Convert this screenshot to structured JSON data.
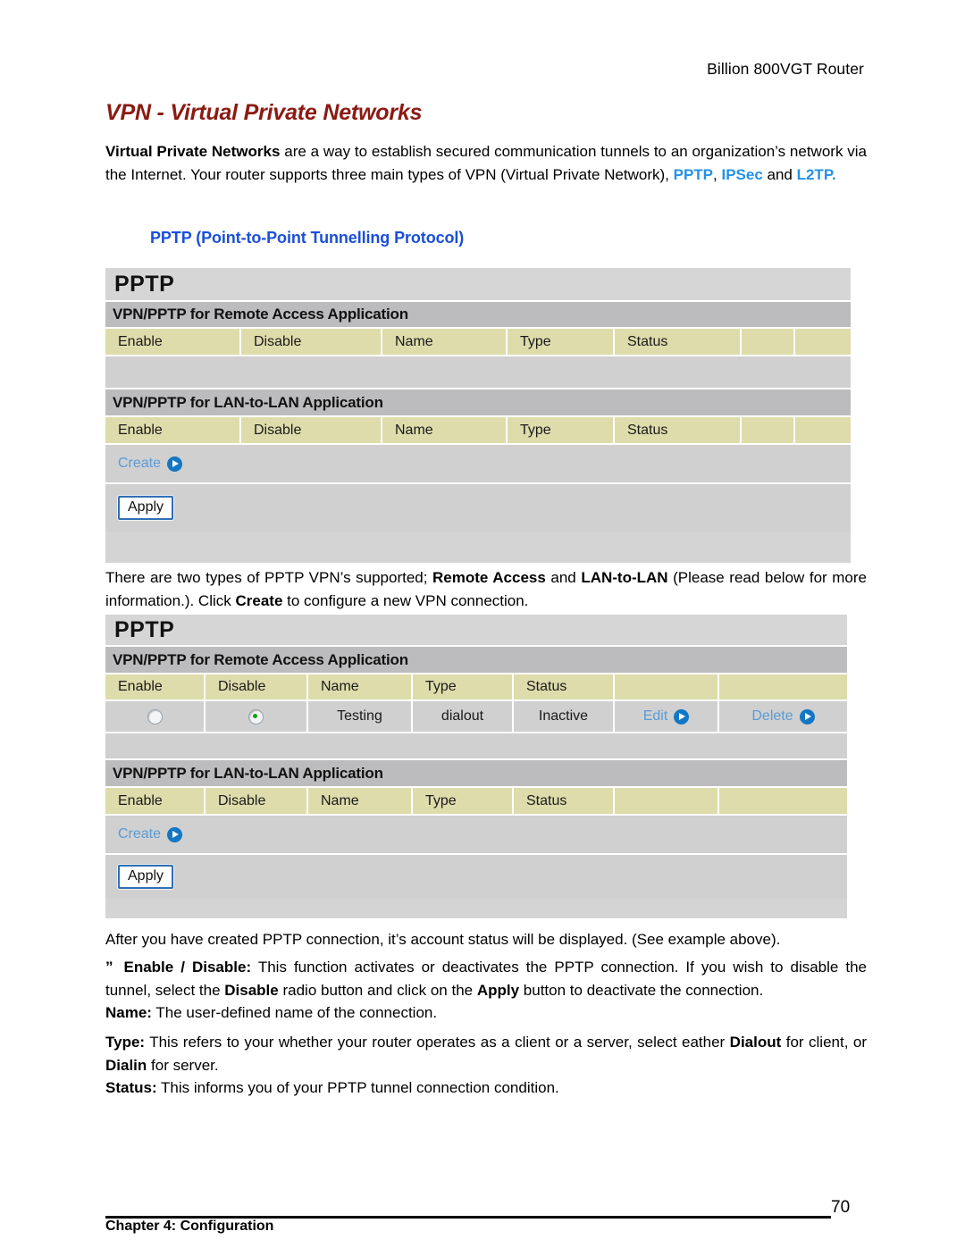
{
  "header": {
    "running_head": "Billion 800VGT Router"
  },
  "title": "VPN - Virtual Private Networks",
  "intro": {
    "lead": "Virtual Private Networks",
    "text_1": " are a way to establish secured communication tunnels to an organization’s network via the Internet. Your router supports three main types of VPN (Virtual Private Network), ",
    "kw_1": "PPTP",
    "sep_1": ", ",
    "kw_2": "IPSec",
    "sep_2": " and ",
    "kw_3": "L2TP."
  },
  "sub_heading": "PPTP (Point-to-Point Tunnelling Protocol)",
  "panel_empty": {
    "title": "PPTP",
    "section_remote": "VPN/PPTP for Remote Access Application",
    "section_lan": "VPN/PPTP for LAN-to-LAN Application",
    "columns": [
      "Enable",
      "Disable",
      "Name",
      "Type",
      "Status",
      "",
      ""
    ],
    "rows": [],
    "create_label": "Create",
    "apply_label": "Apply"
  },
  "paragraph_types": {
    "p1_a": "There are two types of PPTP VPN’s supported; ",
    "p1_b1": "Remote Access",
    "p1_c": " and ",
    "p1_b2": "LAN-to-LAN",
    "p1_d": " (Please read below for more information.). Click ",
    "p1_b3": "Create",
    "p1_e": " to configure a new VPN connection."
  },
  "panel_filled": {
    "title": "PPTP",
    "section_remote": "VPN/PPTP for Remote Access Application",
    "section_lan": "VPN/PPTP for LAN-to-LAN Application",
    "columns": [
      "Enable",
      "Disable",
      "Name",
      "Type",
      "Status",
      "",
      ""
    ],
    "row": {
      "enable_selected": false,
      "disable_selected": true,
      "name": "Testing",
      "type": "dialout",
      "status": "Inactive",
      "edit_label": "Edit",
      "delete_label": "Delete"
    },
    "create_label": "Create",
    "apply_label": "Apply"
  },
  "paragraphs": {
    "after_created": "After you have created PPTP connection, it’s account status will be displayed. (See example above).",
    "bullet_glyph": "”",
    "enable_disable_term": "Enable / Disable:",
    "enable_disable_a": " This function activates or deactivates the PPTP connection. If you wish to disable the tunnel, select the ",
    "enable_disable_b1": "Disable",
    "enable_disable_b": " radio button and click on the ",
    "enable_disable_b2": "Apply",
    "enable_disable_c": " button to deactivate the connection.",
    "name_term": "Name:",
    "name_text": " The user-defined name of the connection.",
    "type_term": "Type:",
    "type_a": " This refers to your whether your router operates as a client or a server, select eather ",
    "type_b1": "Dialout",
    "type_b": " for client, or ",
    "type_b2": "Dialin",
    "type_c": " for server.",
    "status_term": "Status:",
    "status_text": " This informs you of your PPTP tunnel connection condition."
  },
  "footer": {
    "chapter": "Chapter 4: Configuration",
    "page_number": "70"
  },
  "colors": {
    "title_red": "#8b1a12",
    "link_blue": "#2492e8",
    "heading_blue": "#1b4fd8",
    "table_header_bg": "#dedcab",
    "section_bg": "#bcbcbe",
    "panel_bg": "#d0d0d0",
    "arrow_blue": "#1277c4",
    "radio_dot_green": "#15a014"
  }
}
